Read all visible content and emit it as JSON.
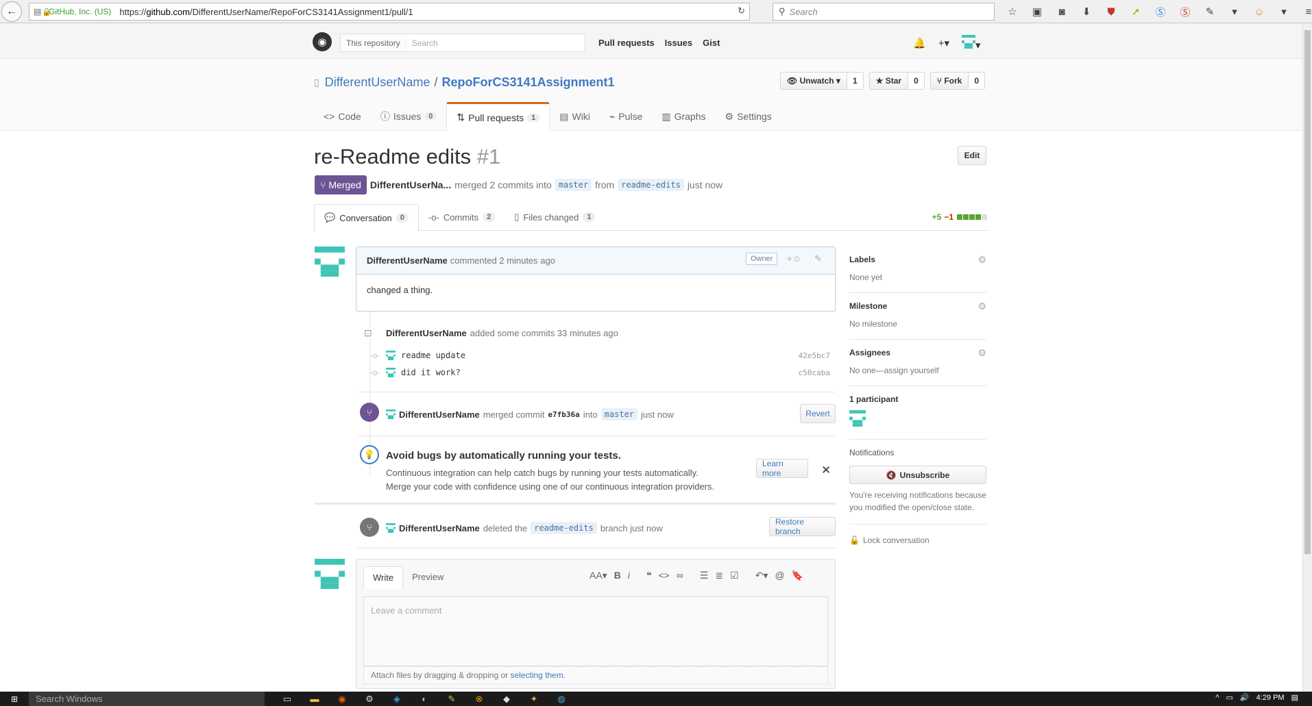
{
  "browser": {
    "identity": "GitHub, Inc. (US)",
    "url_prefix": "https://",
    "url_host": "github.com",
    "url_path": "/DifferentUserName/RepoForCS3141Assignment1/pull/1",
    "search_placeholder": "Search"
  },
  "header": {
    "scope_label": "This repository",
    "search_placeholder": "Search",
    "nav": [
      "Pull requests",
      "Issues",
      "Gist"
    ]
  },
  "repo": {
    "owner": "DifferentUserName",
    "name": "RepoForCS3141Assignment1",
    "unwatch_label": "Unwatch",
    "unwatch_count": "1",
    "star_label": "Star",
    "star_count": "0",
    "fork_label": "Fork",
    "fork_count": "0",
    "tabs": {
      "code": "Code",
      "issues": "Issues",
      "issues_count": "0",
      "pulls": "Pull requests",
      "pulls_count": "1",
      "wiki": "Wiki",
      "pulse": "Pulse",
      "graphs": "Graphs",
      "settings": "Settings"
    }
  },
  "pr": {
    "title": "re-Readme edits",
    "number": "#1",
    "edit_label": "Edit",
    "state": "Merged",
    "author": "DifferentUserNa...",
    "merged_text": "merged 2 commits into",
    "base_branch": "master",
    "from_text": "from",
    "head_branch": "readme-edits",
    "time": "just now",
    "tabs": {
      "conversation": "Conversation",
      "conversation_count": "0",
      "commits": "Commits",
      "commits_count": "2",
      "files": "Files changed",
      "files_count": "1"
    },
    "diff_add": "+5",
    "diff_del": "−1"
  },
  "timeline": {
    "comment": {
      "author": "DifferentUserName",
      "action": "commented 2 minutes ago",
      "badge": "Owner",
      "body": "changed a thing."
    },
    "commits_event": {
      "author": "DifferentUserName",
      "text": "added some commits 33 minutes ago",
      "commits": [
        {
          "message": "readme update",
          "sha": "42e5bc7"
        },
        {
          "message": "did it work?",
          "sha": "c50caba"
        }
      ]
    },
    "merge_event": {
      "author": "DifferentUserName",
      "text": "merged commit",
      "sha": "e7fb36a",
      "into": "into",
      "branch": "master",
      "time": "just now",
      "revert_label": "Revert"
    },
    "ci_promo": {
      "title": "Avoid bugs by automatically running your tests.",
      "line1": "Continuous integration can help catch bugs by running your tests automatically.",
      "line2": "Merge your code with confidence using one of our continuous integration providers.",
      "learn_more": "Learn more",
      "close": "✕"
    },
    "delete_event": {
      "author": "DifferentUserName",
      "text": "deleted the",
      "branch": "readme-edits",
      "suffix": "branch just now",
      "restore_label": "Restore branch"
    }
  },
  "comment_form": {
    "write_tab": "Write",
    "preview_tab": "Preview",
    "placeholder": "Leave a comment",
    "attach_text": "Attach files by dragging & dropping or",
    "attach_link": "selecting them."
  },
  "sidebar": {
    "labels_title": "Labels",
    "labels_value": "None yet",
    "milestone_title": "Milestone",
    "milestone_value": "No milestone",
    "assignees_title": "Assignees",
    "assignees_value": "No one—assign yourself",
    "participants_title": "1 participant",
    "notifications_title": "Notifications",
    "unsubscribe_label": "Unsubscribe",
    "notifications_note": "You're receiving notifications because you modified the open/close state.",
    "lock_label": "Lock conversation"
  },
  "taskbar": {
    "search_placeholder": "Search Windows",
    "clock": "4:29 PM"
  },
  "colors": {
    "merged": "#6e5494",
    "link": "#4078c0",
    "avatar": "#3fc5b8"
  }
}
